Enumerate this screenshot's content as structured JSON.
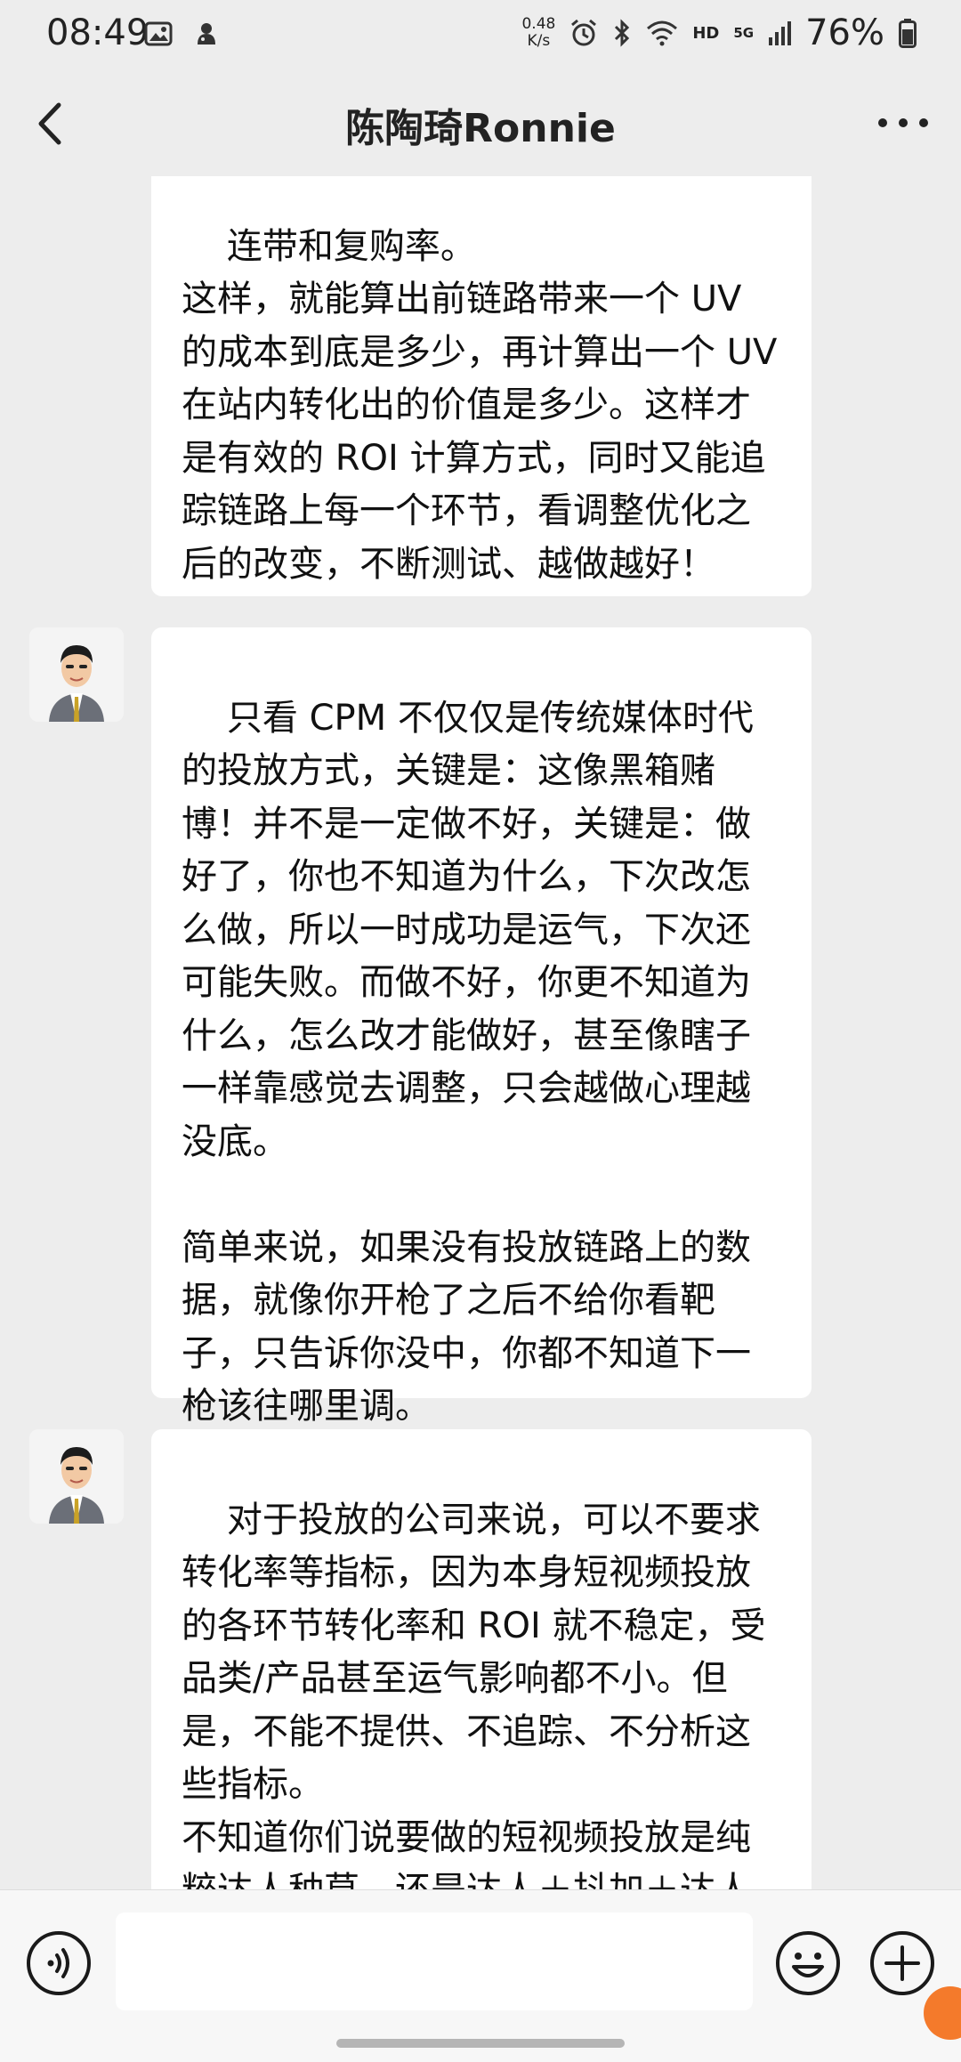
{
  "status_bar": {
    "time": "08:49",
    "net_speed_value": "0.48",
    "net_speed_unit": "K/s",
    "hd_label": "HD",
    "signal_label": "5G",
    "battery_percent": "76%"
  },
  "nav": {
    "title": "陈陶琦Ronnie"
  },
  "messages": [
    {
      "text": "连带和复购率。\n这样，就能算出前链路带来一个 UV 的成本到底是多少，再计算出一个 UV 在站内转化出的价值是多少。这样才是有效的 ROI 计算方式，同时又能追踪链路上每一个环节，看调整优化之后的改变，不断测试、越做越好！"
    },
    {
      "text": "只看 CPM 不仅仅是传统媒体时代的投放方式，关键是：这像黑箱赌博！并不是一定做不好，关键是：做好了，你也不知道为什么，下次改怎么做，所以一时成功是运气，下次还可能失败。而做不好，你更不知道为什么，怎么改才能做好，甚至像瞎子一样靠感觉去调整，只会越做心理越没底。\n\n简单来说，如果没有投放链路上的数据，就像你开枪了之后不给你看靶子，只告诉你没中，你都不知道下一枪该往哪里调。"
    },
    {
      "text": "对于投放的公司来说，可以不要求转化率等指标，因为本身短视频投放的各环节转化率和 ROI 就不稳定，受品类/产品甚至运气影响都不小。但是，不能不提供、不追踪、不分析这些指标。\n不知道你们说要做的短视频投放是纯粹达人种草，还是达人＋抖加＋达人产价，还是信息流投放。"
    }
  ],
  "icons": {
    "back": "chevron-left-icon",
    "more": "more-dots-icon",
    "voice": "voice-icon",
    "emoji": "emoji-icon",
    "plus": "plus-icon"
  }
}
